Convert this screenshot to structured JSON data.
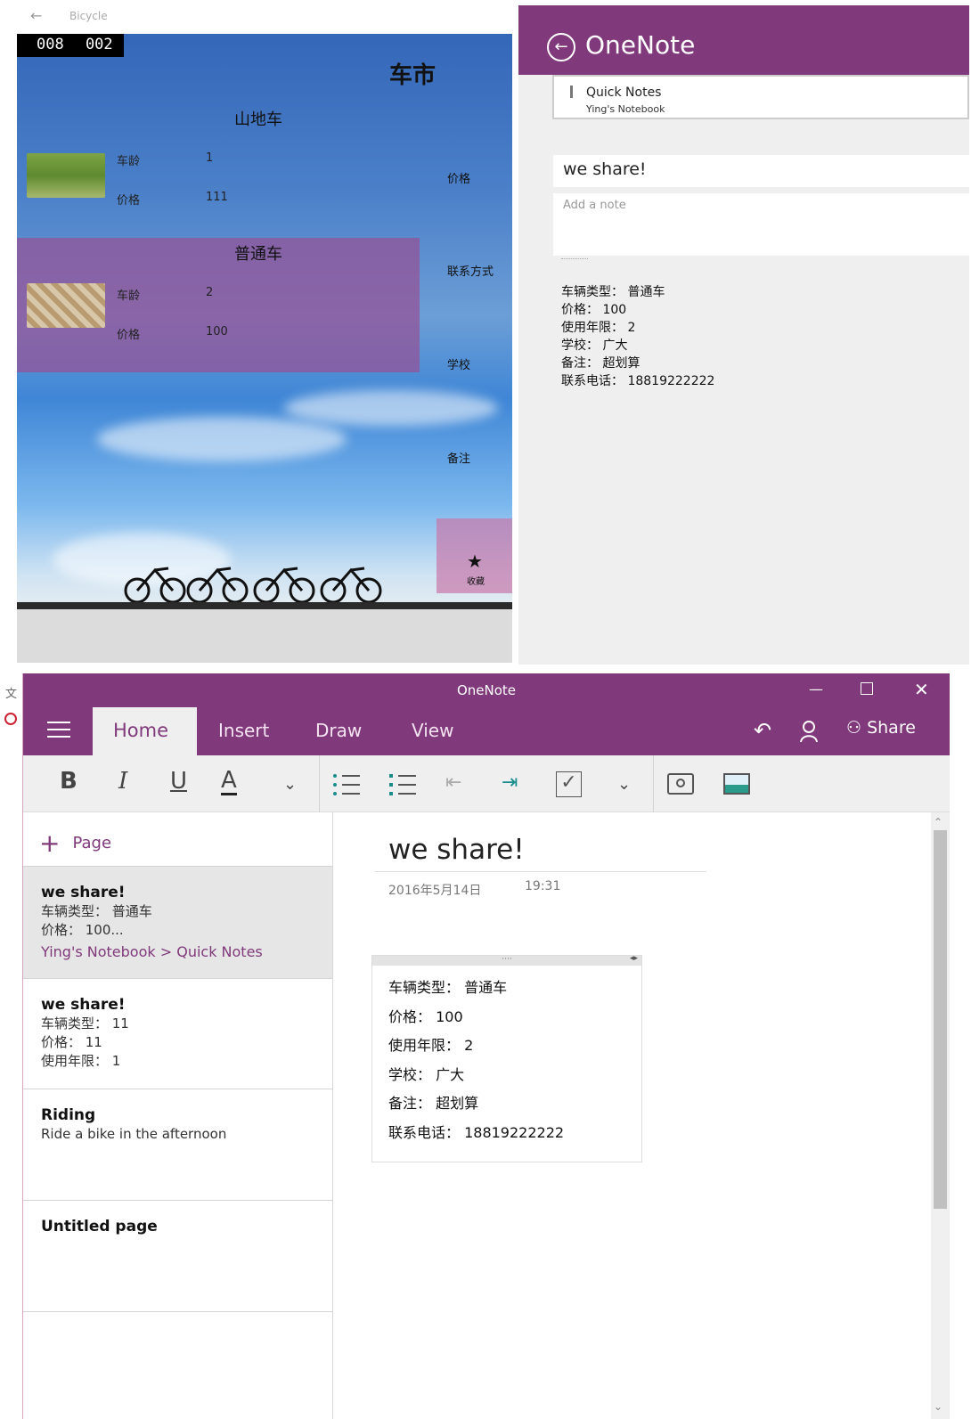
{
  "bike_app": {
    "title": "Bicycle",
    "timer": "008 002",
    "heading": "车市",
    "categories": [
      {
        "name": "山地车",
        "age_label": "车龄",
        "age": "1",
        "price_label": "价格",
        "price": "111"
      },
      {
        "name": "普通车",
        "age_label": "车龄",
        "age": "2",
        "price_label": "价格",
        "price": "100"
      }
    ],
    "side_labels": [
      "价格",
      "联系方式",
      "学校",
      "备注"
    ],
    "favorite_label": "收藏"
  },
  "share_panel": {
    "title": "OneNote",
    "section": "Quick Notes",
    "notebook": "Ying's Notebook",
    "note_title": "we share!",
    "note_placeholder": "Add a note",
    "body": [
      "车辆类型： 普通车",
      "价格： 100",
      "使用年限： 2",
      "学校： 广大",
      "备注： 超划算",
      "联系电话： 18819222222"
    ]
  },
  "onenote": {
    "window_title": "OneNote",
    "tabs": [
      "Home",
      "Insert",
      "Draw",
      "View"
    ],
    "share_label": "Share",
    "toolbar": {
      "bold": "B",
      "italic": "I",
      "underline": "U",
      "font_color": "A"
    },
    "add_page_label": "Page",
    "pages": [
      {
        "title": "we share!",
        "lines": [
          "车辆类型： 普通车",
          "价格： 100..."
        ],
        "crumb": "Ying's Notebook > Quick Notes"
      },
      {
        "title": "we share!",
        "lines": [
          "车辆类型： 11",
          "价格： 11",
          "使用年限： 1"
        ]
      },
      {
        "title": "Riding",
        "lines": [
          "Ride a bike in the afternoon"
        ]
      },
      {
        "title": "Untitled page",
        "lines": []
      }
    ],
    "note": {
      "title": "we share!",
      "date": "2016年5月14日",
      "time": "19:31",
      "content": [
        "车辆类型： 普通车",
        "价格： 100",
        "使用年限： 2",
        "学校： 广大",
        "备注： 超划算",
        "联系电话： 18819222222"
      ]
    }
  },
  "edge_char": "文"
}
